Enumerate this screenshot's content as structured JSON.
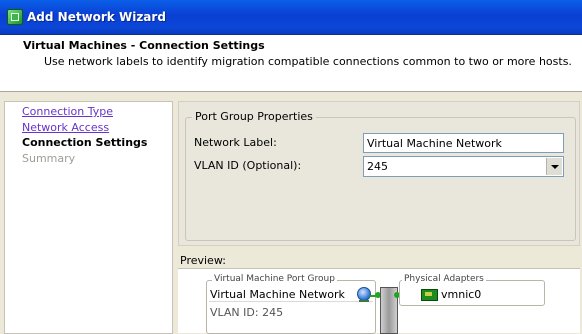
{
  "window": {
    "title": "Add Network Wizard"
  },
  "header": {
    "title": "Virtual Machines - Connection Settings",
    "description": "Use network labels to identify migration compatible connections common to two or more hosts."
  },
  "nav": {
    "items": [
      {
        "label": "Connection Type",
        "state": "link"
      },
      {
        "label": "Network Access",
        "state": "link"
      },
      {
        "label": "Connection Settings",
        "state": "current"
      },
      {
        "label": "Summary",
        "state": "future"
      }
    ]
  },
  "port_group": {
    "legend": "Port Group Properties",
    "network_label_label": "Network Label:",
    "network_label_value": "Virtual Machine Network",
    "vlan_label": "VLAN ID (Optional):",
    "vlan_value": "245"
  },
  "preview": {
    "label": "Preview:",
    "vm_group_legend": "Virtual Machine Port Group",
    "vm_network_name": "Virtual Machine Network",
    "vlan_text": "VLAN ID: 245",
    "physical_adapters_legend": "Physical Adapters",
    "adapter_name": "vmnic0"
  },
  "colors": {
    "titlebar": "#0b46d8",
    "link": "#6633cc",
    "connection": "#1fa51f"
  }
}
